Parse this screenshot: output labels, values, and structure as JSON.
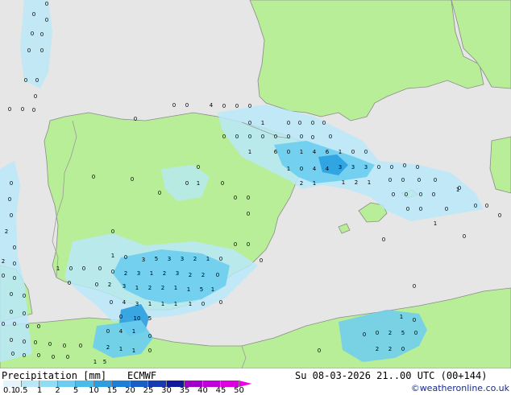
{
  "footer": {
    "title": "Precipitation [mm]",
    "model": "ECMWF",
    "datetime": "Su 08-03-2026 21..00 UTC (00+144)",
    "credit": "©weatheronline.co.uk"
  },
  "legend": {
    "ticks": [
      "0.1",
      "0.5",
      "1",
      "2",
      "5",
      "10",
      "15",
      "20",
      "25",
      "30",
      "35",
      "40",
      "45",
      "50"
    ],
    "colors": [
      "#e4f4fb",
      "#b8e8f8",
      "#90dcf4",
      "#6ccdf0",
      "#48bce8",
      "#2a9ee0",
      "#1e7ed8",
      "#1a5ec8",
      "#183ab4",
      "#101a9a",
      "#a000c8",
      "#c000d8",
      "#dc00e0",
      "#f000e8"
    ]
  },
  "colors": {
    "sea": "#e6e6e6",
    "land": "#b8ee98",
    "coast": "#8a8a8a"
  },
  "precip_labels": [
    "0",
    "1",
    "2",
    "3",
    "4",
    "5",
    "6",
    "10"
  ]
}
